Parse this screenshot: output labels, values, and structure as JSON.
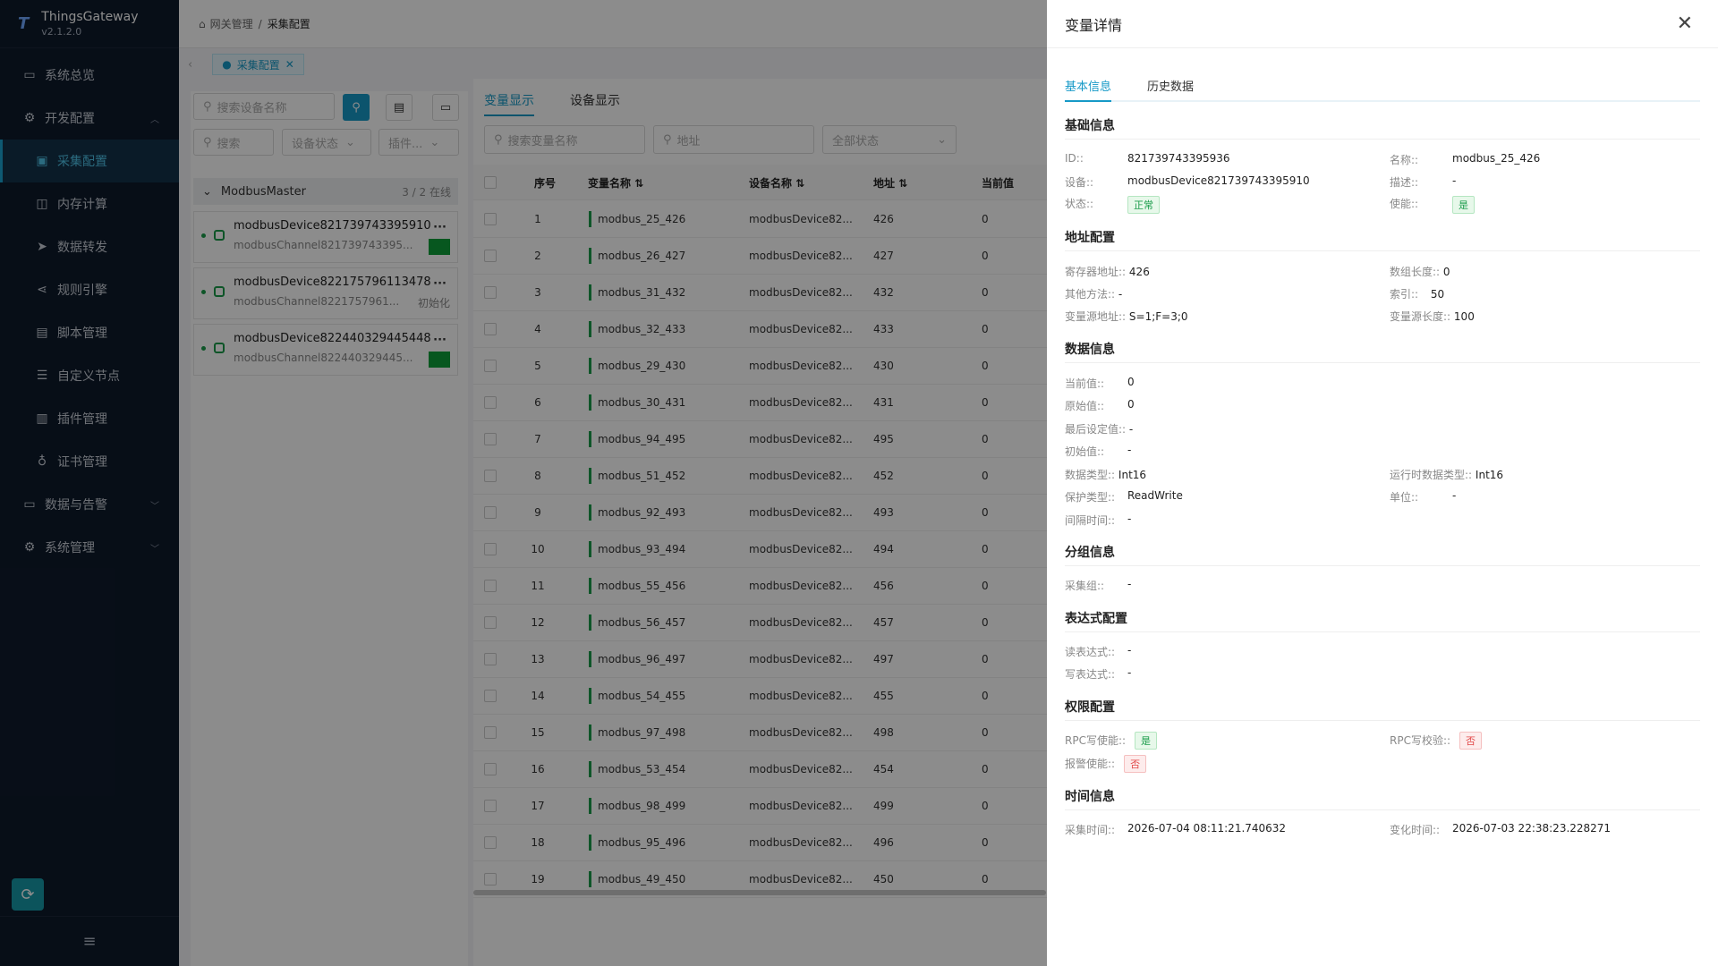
{
  "app": {
    "name": "ThingsGateway",
    "version": "v2.1.2.0"
  },
  "sidebar": {
    "items": [
      {
        "label": "系统总览"
      },
      {
        "label": "开发配置"
      },
      {
        "label": "采集配置"
      },
      {
        "label": "内存计算"
      },
      {
        "label": "数据转发"
      },
      {
        "label": "规则引擎"
      },
      {
        "label": "脚本管理"
      },
      {
        "label": "自定义节点"
      },
      {
        "label": "插件管理"
      },
      {
        "label": "证书管理"
      },
      {
        "label": "数据与告警"
      },
      {
        "label": "系统管理"
      }
    ]
  },
  "breadcrumb": {
    "root": "网关管理",
    "sep": "/",
    "current": "采集配置"
  },
  "tab": {
    "label": "采集配置"
  },
  "left": {
    "search_placeholder": "搜索设备名称",
    "filter_placeholder": "搜索",
    "state_select": "设备状态",
    "plugin_select": "插件...",
    "group": {
      "name": "ModbusMaster",
      "count": "3 / 2 在线"
    },
    "devices": [
      {
        "name": "modbusDevice821739743395910",
        "channel": "modbusChannel821739743395...",
        "state": ""
      },
      {
        "name": "modbusDevice822175796113478",
        "channel": "modbusChannel8221757961...",
        "state": "初始化"
      },
      {
        "name": "modbusDevice822440329445448",
        "channel": "modbusChannel822440329445...",
        "state": ""
      }
    ]
  },
  "center": {
    "tabs": [
      "变量显示",
      "设备显示"
    ],
    "filters": {
      "name_placeholder": "搜索变量名称",
      "addr_placeholder": "地址",
      "status": "全部状态"
    },
    "columns": [
      "序号",
      "变量名称",
      "设备名称",
      "地址",
      "当前值"
    ],
    "rows": [
      [
        "1",
        "modbus_25_426",
        "modbusDevice82...",
        "426",
        "0"
      ],
      [
        "2",
        "modbus_26_427",
        "modbusDevice82...",
        "427",
        "0"
      ],
      [
        "3",
        "modbus_31_432",
        "modbusDevice82...",
        "432",
        "0"
      ],
      [
        "4",
        "modbus_32_433",
        "modbusDevice82...",
        "433",
        "0"
      ],
      [
        "5",
        "modbus_29_430",
        "modbusDevice82...",
        "430",
        "0"
      ],
      [
        "6",
        "modbus_30_431",
        "modbusDevice82...",
        "431",
        "0"
      ],
      [
        "7",
        "modbus_94_495",
        "modbusDevice82...",
        "495",
        "0"
      ],
      [
        "8",
        "modbus_51_452",
        "modbusDevice82...",
        "452",
        "0"
      ],
      [
        "9",
        "modbus_92_493",
        "modbusDevice82...",
        "493",
        "0"
      ],
      [
        "10",
        "modbus_93_494",
        "modbusDevice82...",
        "494",
        "0"
      ],
      [
        "11",
        "modbus_55_456",
        "modbusDevice82...",
        "456",
        "0"
      ],
      [
        "12",
        "modbus_56_457",
        "modbusDevice82...",
        "457",
        "0"
      ],
      [
        "13",
        "modbus_96_497",
        "modbusDevice82...",
        "497",
        "0"
      ],
      [
        "14",
        "modbus_54_455",
        "modbusDevice82...",
        "455",
        "0"
      ],
      [
        "15",
        "modbus_97_498",
        "modbusDevice82...",
        "498",
        "0"
      ],
      [
        "16",
        "modbus_53_454",
        "modbusDevice82...",
        "454",
        "0"
      ],
      [
        "17",
        "modbus_98_499",
        "modbusDevice82...",
        "499",
        "0"
      ],
      [
        "18",
        "modbus_95_496",
        "modbusDevice82...",
        "496",
        "0"
      ],
      [
        "19",
        "modbus_49_450",
        "modbusDevice82...",
        "450",
        "0"
      ]
    ]
  },
  "drawer": {
    "title": "变量详情",
    "close": "✕",
    "tabs": [
      "基本信息",
      "历史数据"
    ],
    "sections": {
      "basic": "基础信息",
      "address": "地址配置",
      "data": "数据信息",
      "group": "分组信息",
      "expr": "表达式配置",
      "perm": "权限配置",
      "time": "时间信息"
    },
    "fields": {
      "id_k": "ID::",
      "id_v": "821739743395936",
      "name_k": "名称::",
      "name_v": "modbus_25_426",
      "device_k": "设备::",
      "device_v": "modbusDevice821739743395910",
      "desc_k": "描述::",
      "desc_v": "-",
      "state_k": "状态::",
      "state_v": "正常",
      "enable_k": "使能::",
      "enable_v": "是",
      "reg_k": "寄存器地址::",
      "reg_v": "426",
      "arrlen_k": "数组长度::",
      "arrlen_v": "0",
      "other_k": "其他方法::",
      "other_v": "-",
      "index_k": "索引::",
      "index_v": "50",
      "srcaddr_k": "变量源地址::",
      "srcaddr_v": "S=1;F=3;0",
      "srclen_k": "变量源长度::",
      "srclen_v": "100",
      "cur_k": "当前值::",
      "cur_v": "0",
      "raw_k": "原始值::",
      "raw_v": "0",
      "last_k": "最后设定值::",
      "last_v": "-",
      "init_k": "初始值::",
      "init_v": "-",
      "dtype_k": "数据类型::",
      "dtype_v": "Int16",
      "rtype_k": "运行时数据类型::",
      "rtype_v": "Int16",
      "prot_k": "保护类型::",
      "prot_v": "ReadWrite",
      "unit_k": "单位::",
      "unit_v": "-",
      "interval_k": "间隔时间::",
      "interval_v": "-",
      "cgroup_k": "采集组::",
      "cgroup_v": "-",
      "rexpr_k": "读表达式::",
      "rexpr_v": "-",
      "wexpr_k": "写表达式::",
      "wexpr_v": "-",
      "rpcw_k": "RPC写使能::",
      "rpcw_v": "是",
      "rpcc_k": "RPC写校验::",
      "rpcc_v": "否",
      "alarm_k": "报警使能::",
      "alarm_v": "否",
      "ctime_k": "采集时间::",
      "ctime_v": "2026-07-04 08:11:21.740632",
      "chtime_k": "变化时间::",
      "chtime_v": "2026-07-03 22:38:23.228271"
    }
  }
}
